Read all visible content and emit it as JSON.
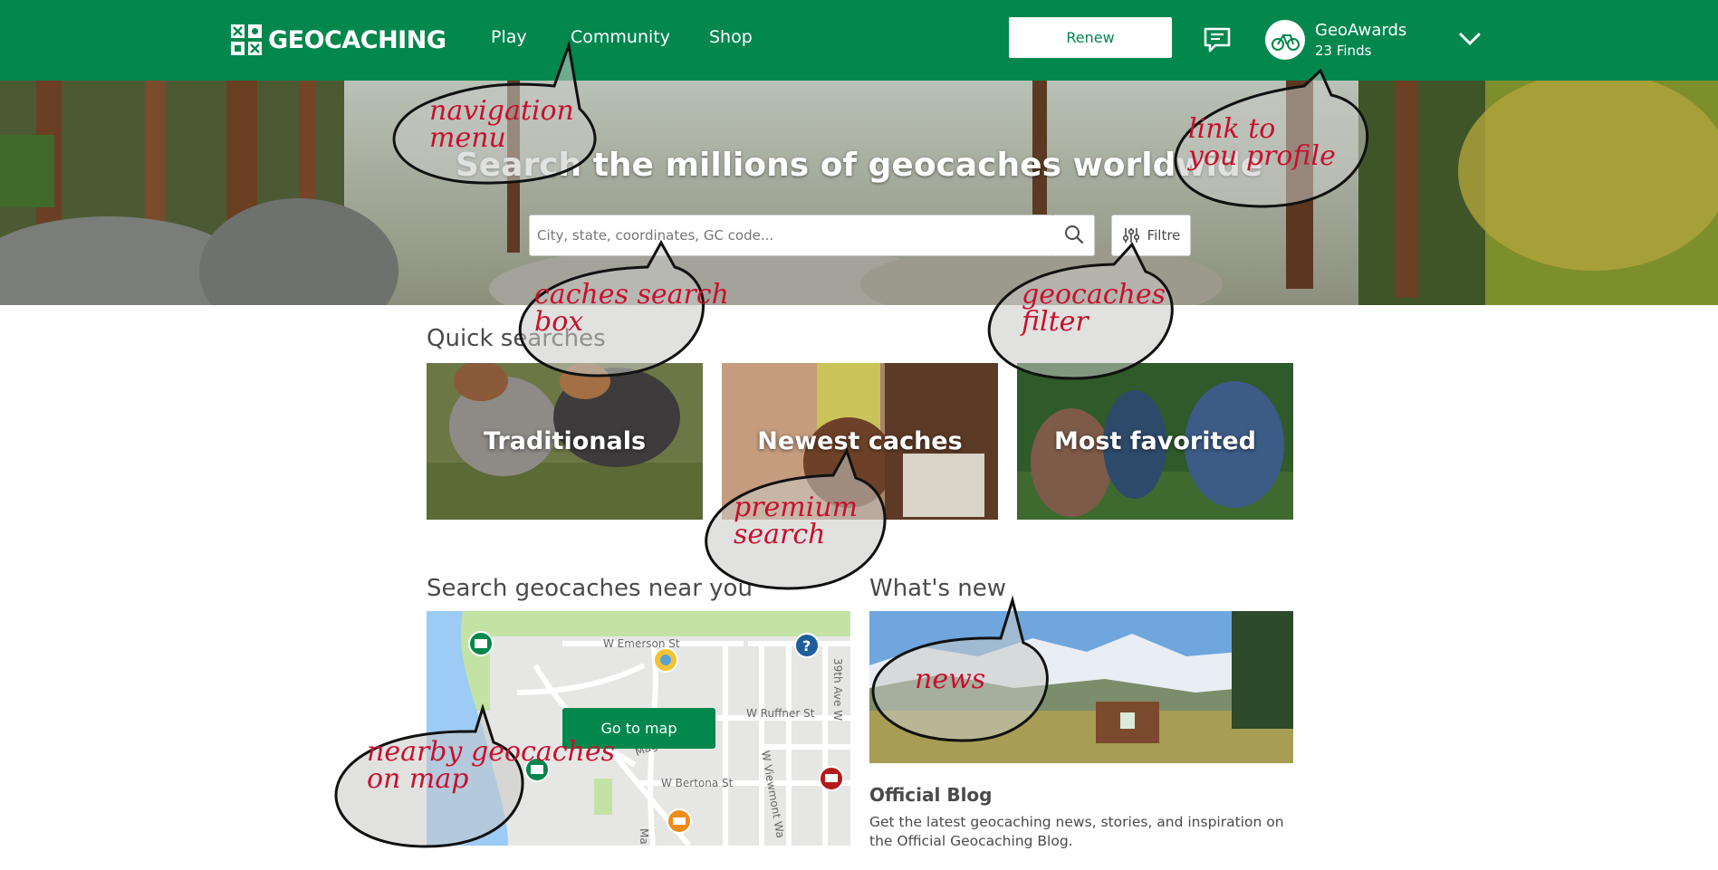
{
  "header": {
    "logo_text": "GEOCACHING",
    "nav": [
      "Play",
      "Community",
      "Shop"
    ],
    "renew_label": "Renew",
    "user_name": "GeoAwards",
    "user_finds": "23 Finds"
  },
  "hero": {
    "title": "Search the millions of geocaches worldwide",
    "search_placeholder": "City, state, coordinates, GC code...",
    "filter_label": "Filtre"
  },
  "quick_searches": {
    "title": "Quick searches",
    "tiles": [
      "Traditionals",
      "Newest caches",
      "Most favorited"
    ]
  },
  "nearby": {
    "title": "Search geocaches near you",
    "map_button": "Go to map",
    "streets": [
      "W Emerson St",
      "W Ruffner St",
      "W Bertona St",
      "39th Ave W",
      "Magnolia Blv",
      "W Viewmont Wa",
      "Ma"
    ]
  },
  "whats_new": {
    "title": "What's new",
    "blog_title": "Official Blog",
    "blog_desc": "Get the latest geocaching news, stories, and inspiration on the Official Geocaching Blog."
  },
  "annotations": [
    "navigation menu",
    "link to you profile",
    "caches search box",
    "geocaches filter",
    "premium search",
    "news",
    "nearby geocaches on map"
  ],
  "colors": {
    "brand_green": "#02874d",
    "annotation_red": "#c8102e"
  }
}
